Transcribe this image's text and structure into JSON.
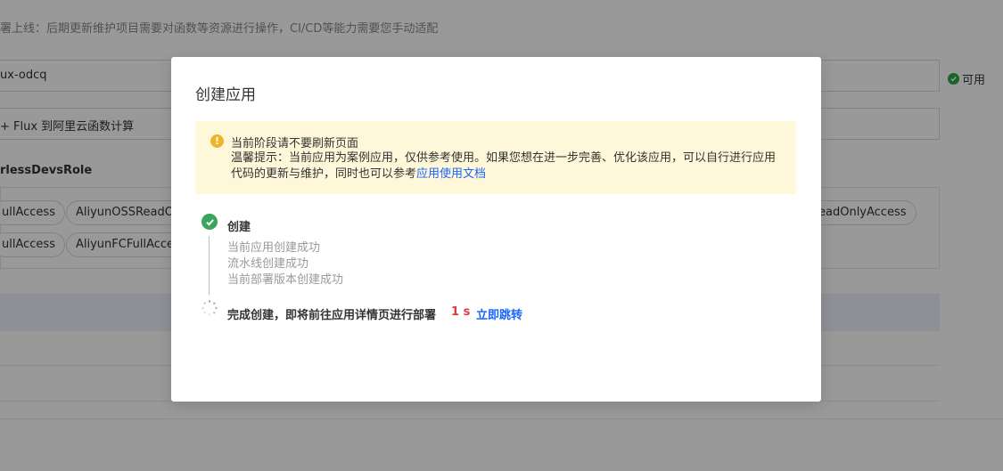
{
  "background": {
    "notice_text": "署上线：后期更新维护项目需要对函数等资源进行操作，CI/CD等能力需要您手动适配",
    "app_name_value": "ux-odcq",
    "status_text": "可用",
    "description_value": "+ Flux 到阿里云函数计算",
    "role_title": "rlessDevsRole",
    "tags_row1": [
      "ullAccess",
      "AliyunOSSReadO",
      "eadOnlyAccess"
    ],
    "tags_row2": [
      "ullAccess",
      "AliyunFCFullAcce"
    ]
  },
  "modal": {
    "title": "创建应用",
    "alert": {
      "title": "当前阶段请不要刷新页面",
      "body_prefix": "温馨提示：当前应用为案例应用，仅供参考使用。如果您想在进一步完善、优化该应用，可以自行进行应用代码的更新与维护，同时也可以参考",
      "link_text": "应用使用文档"
    },
    "steps": [
      {
        "title": "创建",
        "status": "done",
        "details": [
          "当前应用创建成功",
          "流水线创建成功",
          "当前部署版本创建成功"
        ]
      },
      {
        "title": "完成创建，即将前往应用详情页进行部署",
        "status": "loading",
        "countdown": "1 s",
        "action_label": "立即跳转"
      }
    ]
  },
  "colors": {
    "accent": "#1a66ff",
    "success": "#3aa55d",
    "warning": "#f0b429",
    "alert_bg": "#fff7d9",
    "countdown": "#e03a3a"
  }
}
